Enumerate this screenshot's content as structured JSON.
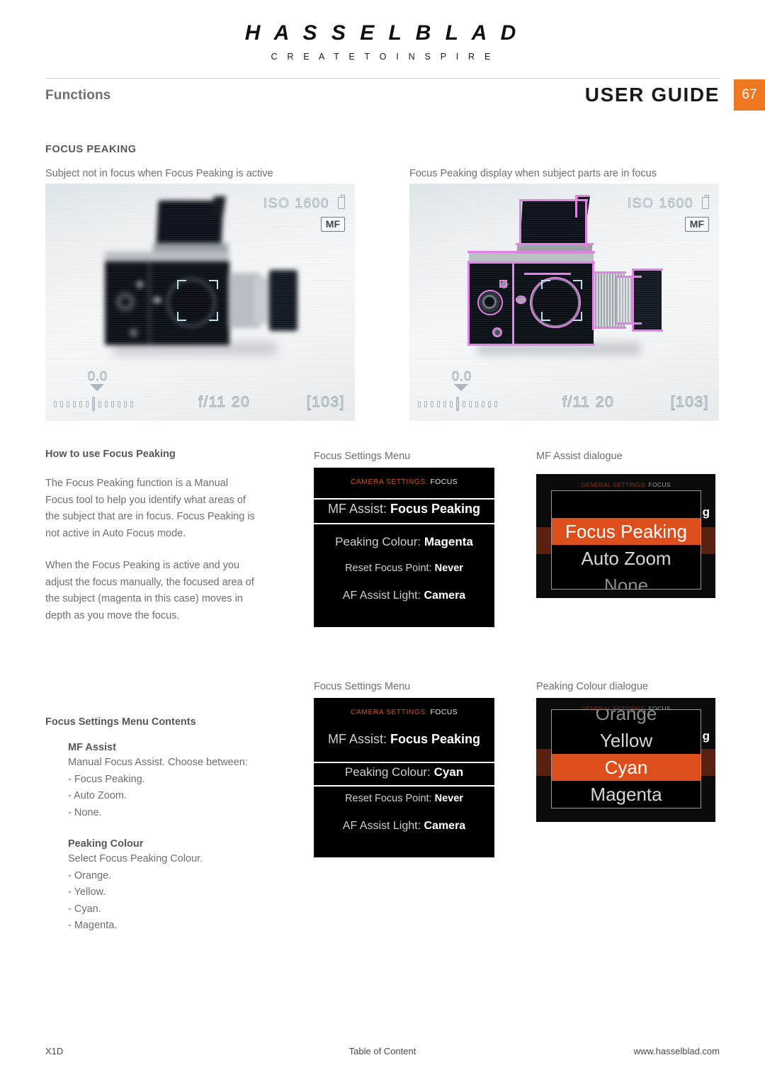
{
  "brand": {
    "name": "H A S S E L B L A D",
    "tagline": "C R E A T E  T O  I N S P I R E"
  },
  "header": {
    "left_title": "Functions",
    "right_title": "USER GUIDE",
    "page_number": "67",
    "accent_color": "#ee7722"
  },
  "section": {
    "title": "FOCUS PEAKING",
    "caption_left": "Subject not in focus when Focus Peaking is active",
    "caption_right": "Focus Peaking display when subject parts are in focus"
  },
  "lcd": {
    "iso": "ISO 1600",
    "focus_mode": "MF",
    "exposure_comp": "0.0",
    "aperture_shutter": "f/11  20",
    "frames_remaining": "[103]",
    "peaking_color": "#e87fe8",
    "af_frame_color": "#bfe0ea"
  },
  "article": {
    "heading": "How to use Focus Peaking",
    "para1": "The Focus Peaking function is a Manual Focus tool to help you identify what areas of the subject that are in focus. Focus Peaking is not active in Auto Focus mode.",
    "para2": "When the Focus Peaking is active and you adjust the focus manually, the focused area of the subject (magenta in this case) moves in depth as you move the focus.",
    "contents_heading": "Focus Settings Menu Contents",
    "mf_assist": {
      "title": "MF Assist",
      "desc": "Manual Focus Assist. Choose between:",
      "options": [
        "- Focus Peaking.",
        "- Auto Zoom.",
        "- None."
      ]
    },
    "peaking_colour": {
      "title": "Peaking Colour",
      "desc": "Select Focus Peaking Colour.",
      "options": [
        "- Orange.",
        "- Yellow.",
        "- Cyan.",
        "- Magenta."
      ]
    }
  },
  "menu_screens": [
    {
      "caption": "Focus Settings Menu",
      "header_label": "CAMERA SETTINGS:",
      "header_value": "FOCUS",
      "rows": [
        {
          "label": "MF Assist:",
          "value": "Focus Peaking",
          "selected": true
        },
        {
          "label": "Peaking Colour:",
          "value": "Magenta",
          "selected": false
        },
        {
          "label": "Reset Focus Point:",
          "value": "Never",
          "selected": false
        },
        {
          "label": "AF Assist Light:",
          "value": "Camera",
          "selected": false
        }
      ]
    },
    {
      "caption": "Focus Settings Menu",
      "header_label": "CAMERA SETTINGS:",
      "header_value": "FOCUS",
      "rows": [
        {
          "label": "MF Assist:",
          "value": "Focus Peaking",
          "selected": false
        },
        {
          "label": "Peaking Colour:",
          "value": "Cyan",
          "selected": true
        },
        {
          "label": "Reset Focus Point:",
          "value": "Never",
          "selected": false
        },
        {
          "label": "AF Assist Light:",
          "value": "Camera",
          "selected": false
        }
      ]
    }
  ],
  "dialogues": [
    {
      "caption": "MF Assist dialogue",
      "header_label": "GENERAL SETTINGS:",
      "header_value": "FOCUS",
      "ghost_text": "g",
      "options": [
        {
          "label": "",
          "state": "blank"
        },
        {
          "label": "Focus Peaking",
          "state": "highlighted"
        },
        {
          "label": "Auto Zoom",
          "state": "normal"
        },
        {
          "label": "None",
          "state": "clipped"
        }
      ],
      "highlight_color": "#dc4e1b"
    },
    {
      "caption": "Peaking Colour dialogue",
      "header_label": "GENERAL SETTINGS:",
      "header_value": "FOCUS",
      "ghost_text": "g",
      "options": [
        {
          "label": "Orange",
          "state": "clipped"
        },
        {
          "label": "Yellow",
          "state": "normal"
        },
        {
          "label": "Cyan",
          "state": "highlighted"
        },
        {
          "label": "Magenta",
          "state": "normal"
        }
      ],
      "highlight_color": "#dc4e1b"
    }
  ],
  "footer": {
    "left": "X1D",
    "center": "Table of Content",
    "right": "www.hasselblad.com"
  }
}
